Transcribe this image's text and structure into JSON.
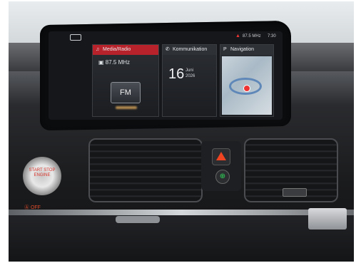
{
  "status_bar": {
    "warning_icon": "warning-triangle-icon",
    "frequency": "87.5 MHz",
    "time": "7:30"
  },
  "tiles": {
    "media": {
      "title": "Media/Radio",
      "frequency": "87.5 MHz",
      "source_button": "FM"
    },
    "communication": {
      "title": "Kommunikation",
      "day": "16",
      "month": "Juni",
      "year": "2026"
    },
    "navigation": {
      "title": "Navigation"
    }
  },
  "controls": {
    "start_button": "START STOP ENGINE",
    "eco_label": "OFF"
  },
  "colors": {
    "accent_red": "#b8222a",
    "eco_green": "#2fd95a",
    "hazard_red": "#e42222"
  }
}
